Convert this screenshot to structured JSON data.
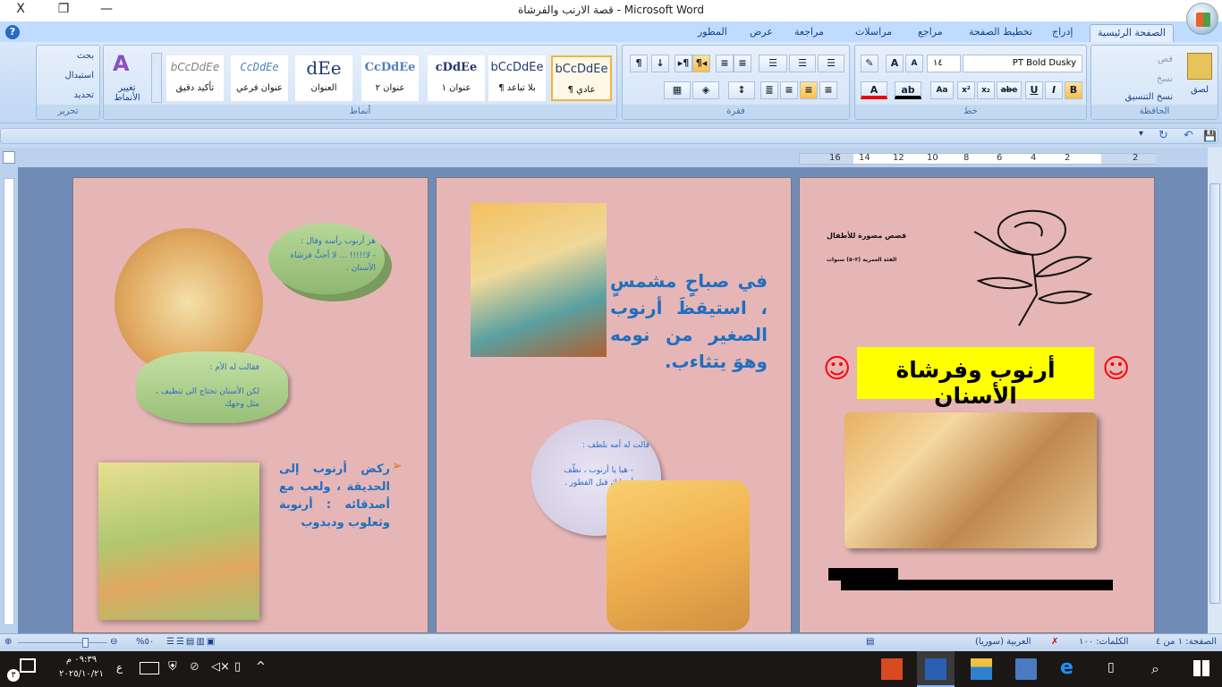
{
  "window": {
    "title": "قصة الارنب والفرشاة - Microsoft Word",
    "close": "X",
    "restore": "❐",
    "minimize": "—"
  },
  "tabs": [
    "الصفحة الرئيسية",
    "إدراج",
    "تخطيط الصفحة",
    "مراجع",
    "مراسلات",
    "مراجعة",
    "عرض",
    "المطور"
  ],
  "ribbon": {
    "clipboard": {
      "label": "الحافظة",
      "paste": "لصق",
      "cut": "قص",
      "copy": "نسخ",
      "format_painter": "نسخ التنسيق"
    },
    "font": {
      "label": "خط",
      "font_name": "PT Bold Dusky",
      "font_size": "١٤",
      "bold": "B",
      "italic": "I",
      "underline": "U",
      "strike": "abe",
      "subscript": "x₂",
      "superscript": "x²",
      "change_case": "Aa",
      "grow": "A",
      "shrink": "A"
    },
    "paragraph": {
      "label": "فقرة"
    },
    "styles": {
      "label": "أنماط",
      "change_styles": "تغيير الأنماط",
      "items": [
        {
          "label": "¶ عادي",
          "preview": "bCcDdEe",
          "selected": true
        },
        {
          "label": "¶ بلا تباعد",
          "preview": "bCcDdEe"
        },
        {
          "label": "عنوان ١",
          "preview": "cDdEe"
        },
        {
          "label": "عنوان ٢",
          "preview": "CcDdEe"
        },
        {
          "label": "العنوان",
          "preview": "dEe"
        },
        {
          "label": "عنوان فرعي",
          "preview": "CcDdEe"
        },
        {
          "label": "تأكيد دقيق",
          "preview": "bCcDdEe"
        }
      ]
    },
    "editing": {
      "label": "تحرير",
      "find": "بحث",
      "replace": "استبدال",
      "select": "تحديد"
    }
  },
  "ruler": {
    "ticks": [
      "16",
      "14",
      "12",
      "10",
      "8",
      "6",
      "4",
      "2",
      "2"
    ]
  },
  "pages": {
    "cover": {
      "subtitle": "قصص مصورة للأطفال",
      "age": "الفئة العمرية (٣–٥) سنوات",
      "title": "أرنوب وفرشاة الأسنان",
      "smiley": "☺"
    },
    "page2": {
      "text": "في صباحٍ مشمسٍ ، استيقظَ أرنوب الصغير من نومه وهوَ يتثاءب.",
      "bubble_line1": "قالت له أمه بلطف :",
      "bubble_line2": "- هيا يا أرنوب ، نظّف أسنانك قبل الفطور ."
    },
    "page1": {
      "bubble1_line1": "هز أرنوب رأسه وقال :",
      "bubble1_line2": "- لا!!!!! ... لا أحبُّ فرشاة الأسنان .",
      "bubble2_line1": "فقالت له الأم :",
      "bubble2_line2": "لكن الأسنان تحتاج الى تنظيف ، مثل وجهك",
      "text": "ركض أرنوب إلى الحديقة ، ولعب مع أصدقائه : أرنوبة وثعلوب ودبدوب",
      "bullet": "➢"
    }
  },
  "status": {
    "page": "الصفحة: ١ من ٤",
    "words": "الكلمات: ١٠٠",
    "language": "العربية (سوريا)",
    "zoom": "%٥٠"
  },
  "taskbar": {
    "time": "٠٩:٣٩ م",
    "date": "٢٠٢٥/١٠/٢١",
    "lang": "ع",
    "notifications": "٣"
  },
  "colors": {
    "page": "#e6b6b6",
    "text_blue": "#1f6fc0",
    "title_highlight": "#ffff00",
    "smiley": "#ff0000"
  }
}
